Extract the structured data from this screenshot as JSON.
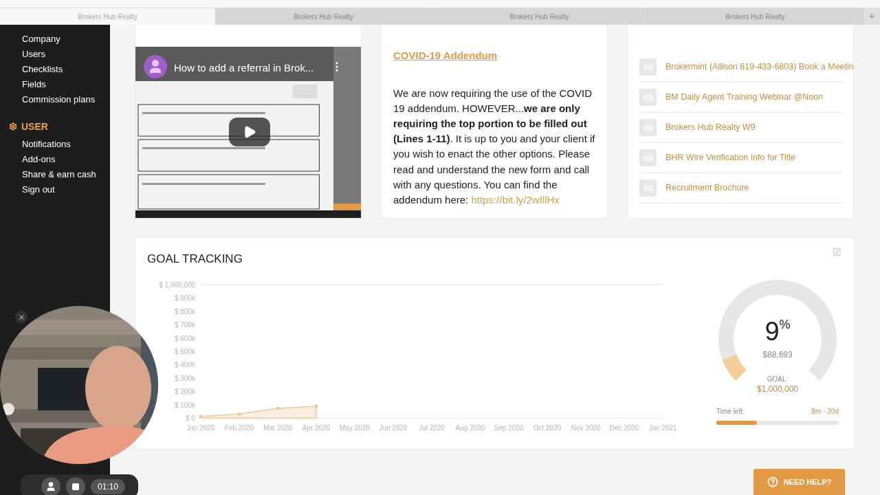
{
  "browser": {
    "tabs": [
      {
        "label": "Brokers Hub Realty",
        "selected": true
      },
      {
        "label": "Brokers Hub Realty",
        "selected": false
      },
      {
        "label": "Brokers Hub Realty",
        "selected": false
      },
      {
        "label": "Brokers Hub Realty",
        "selected": false
      }
    ],
    "new_tab": "+"
  },
  "sidebar": {
    "items": [
      {
        "label": "Company"
      },
      {
        "label": "Users"
      },
      {
        "label": "Checklists"
      },
      {
        "label": "Fields"
      },
      {
        "label": "Commission plans"
      }
    ],
    "section": {
      "title": "USER",
      "items": [
        {
          "label": "Notifications"
        },
        {
          "label": "Add-ons"
        },
        {
          "label": "Share & earn cash"
        },
        {
          "label": "Sign out"
        }
      ]
    }
  },
  "video": {
    "title": "How to add a referral in Brok...",
    "kind": "picture"
  },
  "announcement": {
    "title": "COVID-19 Addendum",
    "text": "We are now requiring the use of the COVID 19 addendum. HOWEVER...**we are only requiring the top portion to be filled out (Lines 1-11)**. It is up to you and your client if you wish to enact the other options. Please read and understand the new form and call with any questions. You can find the addendum here: ",
    "link": "https://bit.ly/2wIllHx"
  },
  "links": [
    {
      "label": "Brokermint (Allison 619-433-6803) Book a Meetin"
    },
    {
      "label": "BM Daily Agent Training Webinar @Noon"
    },
    {
      "label": "Brokers Hub Realty W9"
    },
    {
      "label": "BHR Wire Verification Info for Title"
    },
    {
      "label": "Recruitment Brochure"
    }
  ],
  "goal_tracking": {
    "title": "GOAL TRACKING",
    "chart_data": {
      "type": "area",
      "categories": [
        "Jan 2020",
        "Feb 2020",
        "Mar 2020",
        "Apr 2020",
        "May 2020",
        "Jun 2020",
        "Jul 2020",
        "Aug 2020",
        "Sep 2020",
        "Oct 2020",
        "Nov 2020",
        "Dec 2020",
        "Jan 2021"
      ],
      "series": [
        {
          "color": "#edc99a",
          "values": [
            12000,
            30000,
            72000,
            89000,
            null,
            null,
            null,
            null,
            null,
            null,
            null,
            null,
            null
          ]
        }
      ],
      "ylim": [
        0,
        1000000
      ],
      "yticks": [
        {
          "value": 0,
          "label": "$ 0"
        },
        {
          "value": 100000,
          "label": "$ 100k"
        },
        {
          "value": 200000,
          "label": "$ 200k"
        },
        {
          "value": 300000,
          "label": "$ 300k"
        },
        {
          "value": 400000,
          "label": "$ 400k"
        },
        {
          "value": 500000,
          "label": "$ 500k"
        },
        {
          "value": 600000,
          "label": "$ 600k"
        },
        {
          "value": 700000,
          "label": "$ 700k"
        },
        {
          "value": 800000,
          "label": "$ 800k"
        },
        {
          "value": 900000,
          "label": "$ 900k"
        },
        {
          "value": 1000000,
          "label": "$ 1,000,000"
        }
      ]
    },
    "gauge": {
      "value": "9",
      "unit": "%",
      "amount": "$88,693",
      "goal_label": "GOAL:",
      "goal_value": "$1,000,000",
      "level": 0.09
    },
    "time_left": {
      "label": "Time left:",
      "value": "8m · 20d",
      "level": 0.33
    }
  },
  "recorder": {
    "timer": "01:10"
  },
  "help_button": {
    "label": "NEED HELP?"
  }
}
